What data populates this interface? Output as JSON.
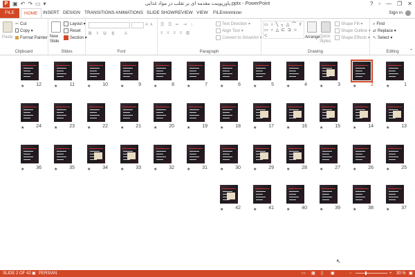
{
  "window": {
    "title": "پاورپوینت مقدمه ای بر تقلب در مواد غذایی.pptx - PowerPoint",
    "help": "?",
    "minimize": "—",
    "restore": "❐",
    "close": "✕"
  },
  "tabs": {
    "file": "FILE",
    "home": "HOME",
    "insert": "INSERT",
    "design": "DESIGN",
    "transitions": "TRANSITIONS",
    "animations": "ANIMATIONS",
    "slideshow": "SLIDE SHOW",
    "review": "REVIEW",
    "view": "VIEW",
    "filemin": "FILEminimizer"
  },
  "signin": "Sign in",
  "ribbon": {
    "clipboard": {
      "label": "Clipboard",
      "paste": "Paste",
      "cut": "Cut",
      "copy": "Copy",
      "format_painter": "Format Painter"
    },
    "slides": {
      "label": "Slides",
      "new_slide": "New Slide",
      "layout": "Layout",
      "reset": "Reset",
      "section": "Section"
    },
    "font": {
      "label": "Font"
    },
    "paragraph": {
      "label": "Paragraph",
      "text_direction": "Text Direction",
      "align_text": "Align Text",
      "convert": "Convert to SmartArt"
    },
    "drawing": {
      "label": "Drawing",
      "arrange": "Arrange",
      "quick_styles": "Quick Styles",
      "shape_fill": "Shape Fill",
      "shape_outline": "Shape Outline",
      "shape_effects": "Shape Effects"
    },
    "editing": {
      "label": "Editing",
      "find": "Find",
      "replace": "Replace",
      "select": "Select"
    }
  },
  "slides": {
    "selected": 2,
    "rows": [
      [
        12,
        11,
        10,
        9,
        8,
        7,
        6,
        5,
        4,
        3,
        2,
        1
      ],
      [
        24,
        23,
        22,
        21,
        20,
        19,
        18,
        17,
        16,
        15,
        14,
        13
      ],
      [
        36,
        35,
        34,
        33,
        32,
        31,
        30,
        29,
        28,
        27,
        26,
        25
      ],
      [
        42,
        41,
        40,
        39,
        38,
        37
      ]
    ],
    "star": "★"
  },
  "status": {
    "slide_of": "SLIDE 2 OF 42",
    "language": "PERSIAN",
    "zoom": "30 %",
    "zoom_percent": 30
  },
  "colors": {
    "accent": "#d24726",
    "thumb_bg": "#231f24",
    "thumb_accent": "#c4302b"
  }
}
